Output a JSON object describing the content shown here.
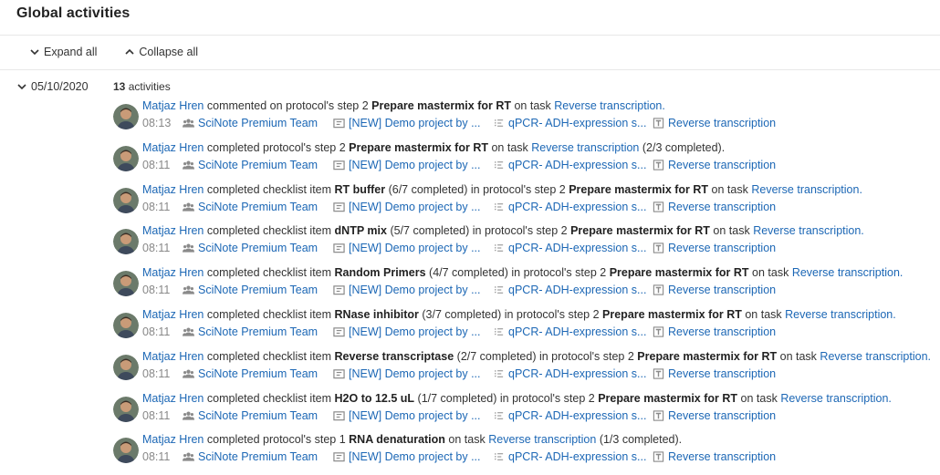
{
  "page": {
    "title": "Global activities"
  },
  "toolbar": {
    "expand_label": "Expand all",
    "collapse_label": "Collapse all"
  },
  "group": {
    "date": "05/10/2020",
    "count": "13",
    "count_suffix": "activities"
  },
  "activities": [
    {
      "user": "Matjaz Hren",
      "pre": "commented on protocol's step 2",
      "bold1": "Prepare mastermix for RT",
      "mid": "on task",
      "bold2": "",
      "post": "",
      "task_link": "Reverse transcription.",
      "tail": "",
      "time": "08:13",
      "team": "SciNote Premium Team",
      "project": "[NEW] Demo project by ...",
      "experiment": "qPCR- ADH-expression s...",
      "task": "Reverse transcription"
    },
    {
      "user": "Matjaz Hren",
      "pre": "completed protocol's step 2",
      "bold1": "Prepare mastermix for RT",
      "mid": "on task",
      "bold2": "",
      "post": "",
      "task_link": "Reverse transcription",
      "tail": "(2/3 completed).",
      "time": "08:11",
      "team": "SciNote Premium Team",
      "project": "[NEW] Demo project by ...",
      "experiment": "qPCR- ADH-expression s...",
      "task": "Reverse transcription"
    },
    {
      "user": "Matjaz Hren",
      "pre": "completed checklist item",
      "bold1": "RT buffer",
      "mid": "(6/7 completed) in protocol's step 2",
      "bold2": "Prepare mastermix for RT",
      "post": "on task",
      "task_link": "Reverse transcription.",
      "tail": "",
      "time": "08:11",
      "team": "SciNote Premium Team",
      "project": "[NEW] Demo project by ...",
      "experiment": "qPCR- ADH-expression s...",
      "task": "Reverse transcription"
    },
    {
      "user": "Matjaz Hren",
      "pre": "completed checklist item",
      "bold1": "dNTP mix",
      "mid": "(5/7 completed) in protocol's step 2",
      "bold2": "Prepare mastermix for RT",
      "post": "on task",
      "task_link": "Reverse transcription.",
      "tail": "",
      "time": "08:11",
      "team": "SciNote Premium Team",
      "project": "[NEW] Demo project by ...",
      "experiment": "qPCR- ADH-expression s...",
      "task": "Reverse transcription"
    },
    {
      "user": "Matjaz Hren",
      "pre": "completed checklist item",
      "bold1": "Random Primers",
      "mid": "(4/7 completed) in protocol's step 2",
      "bold2": "Prepare mastermix for RT",
      "post": "on task",
      "task_link": "Reverse transcription.",
      "tail": "",
      "time": "08:11",
      "team": "SciNote Premium Team",
      "project": "[NEW] Demo project by ...",
      "experiment": "qPCR- ADH-expression s...",
      "task": "Reverse transcription"
    },
    {
      "user": "Matjaz Hren",
      "pre": "completed checklist item",
      "bold1": "RNase inhibitor",
      "mid": "(3/7 completed) in protocol's step 2",
      "bold2": "Prepare mastermix for RT",
      "post": "on task",
      "task_link": "Reverse transcription.",
      "tail": "",
      "time": "08:11",
      "team": "SciNote Premium Team",
      "project": "[NEW] Demo project by ...",
      "experiment": "qPCR- ADH-expression s...",
      "task": "Reverse transcription"
    },
    {
      "user": "Matjaz Hren",
      "pre": "completed checklist item",
      "bold1": "Reverse transcriptase",
      "mid": "(2/7 completed) in protocol's step 2",
      "bold2": "Prepare mastermix for RT",
      "post": "on task",
      "task_link": "Reverse transcription.",
      "tail": "",
      "time": "08:11",
      "team": "SciNote Premium Team",
      "project": "[NEW] Demo project by ...",
      "experiment": "qPCR- ADH-expression s...",
      "task": "Reverse transcription"
    },
    {
      "user": "Matjaz Hren",
      "pre": "completed checklist item",
      "bold1": "H2O to 12.5 uL",
      "mid": "(1/7 completed) in protocol's step 2",
      "bold2": "Prepare mastermix for RT",
      "post": "on task",
      "task_link": "Reverse transcription.",
      "tail": "",
      "time": "08:11",
      "team": "SciNote Premium Team",
      "project": "[NEW] Demo project by ...",
      "experiment": "qPCR- ADH-expression s...",
      "task": "Reverse transcription"
    },
    {
      "user": "Matjaz Hren",
      "pre": "completed protocol's step 1",
      "bold1": "RNA denaturation",
      "mid": "on task",
      "bold2": "",
      "post": "",
      "task_link": "Reverse transcription",
      "tail": "(1/3 completed).",
      "time": "08:11",
      "team": "SciNote Premium Team",
      "project": "[NEW] Demo project by ...",
      "experiment": "qPCR- ADH-expression s...",
      "task": "Reverse transcription"
    }
  ]
}
